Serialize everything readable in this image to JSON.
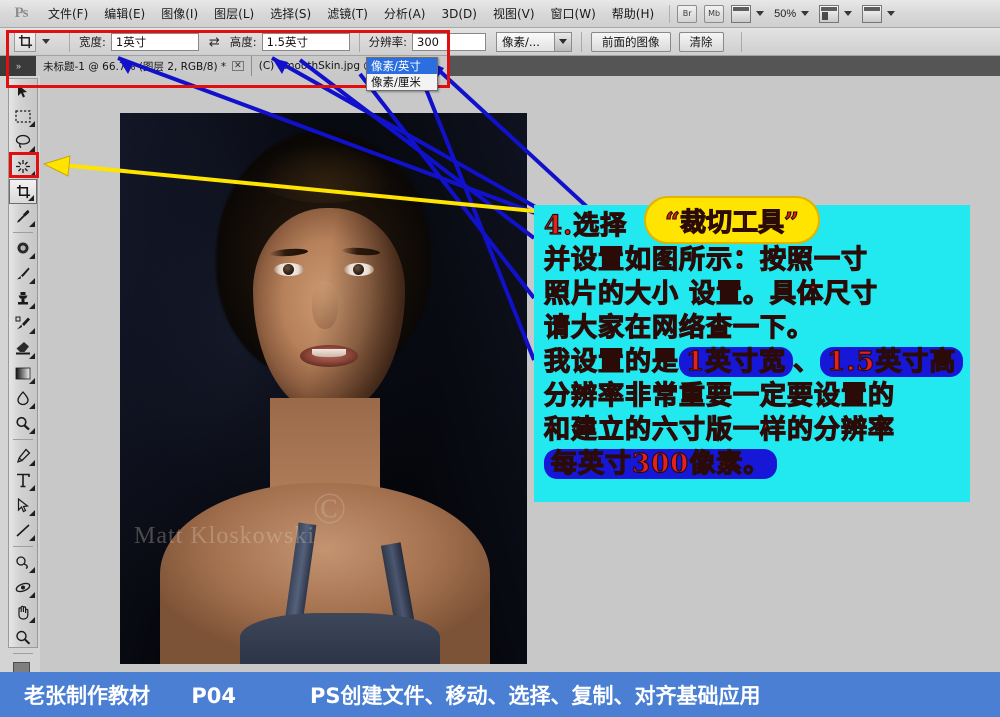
{
  "app": {
    "logo": "Ps",
    "menus": [
      {
        "label": "文件(F)"
      },
      {
        "label": "编辑(E)"
      },
      {
        "label": "图像(I)"
      },
      {
        "label": "图层(L)"
      },
      {
        "label": "选择(S)"
      },
      {
        "label": "滤镜(T)"
      },
      {
        "label": "分析(A)"
      },
      {
        "label": "3D(D)"
      },
      {
        "label": "视图(V)"
      },
      {
        "label": "窗口(W)"
      },
      {
        "label": "帮助(H)"
      }
    ],
    "bridge_button": "Br",
    "minibridge_button": "Mb",
    "zoom_level": "50%"
  },
  "options_bar": {
    "tool_icon": "crop-tool-icon",
    "width_label": "宽度:",
    "width_value": "1英寸",
    "swap_icon": "swap-width-height-icon",
    "height_label": "高度:",
    "height_value": "1.5英寸",
    "resolution_label": "分辨率:",
    "resolution_value": "300",
    "unit_value": "像素/...",
    "front_image_button": "前面的图像",
    "clear_button": "清除"
  },
  "unit_dropdown": {
    "options": [
      {
        "label": "像素/英寸",
        "selected": true
      },
      {
        "label": "像素/厘米",
        "selected": false
      }
    ]
  },
  "tabs": [
    {
      "label": "未标题-1 @ 66.7% (图层 2, RGB/8) *",
      "close": "✕"
    },
    {
      "label": "(C) SmoothSkin.jpg @ 50% (RGB...",
      "close": ""
    }
  ],
  "toolbar": {
    "tools": [
      {
        "name": "move-tool",
        "has_flyout": false
      },
      {
        "name": "rectangular-marquee-tool",
        "has_flyout": true
      },
      {
        "name": "lasso-tool",
        "has_flyout": true
      },
      {
        "name": "magic-wand-tool",
        "has_flyout": true
      },
      {
        "name": "crop-tool",
        "has_flyout": true,
        "active": true
      },
      {
        "name": "eyedropper-tool",
        "has_flyout": true
      },
      {
        "name": "spot-healing-brush-tool",
        "has_flyout": true
      },
      {
        "name": "brush-tool",
        "has_flyout": true
      },
      {
        "name": "clone-stamp-tool",
        "has_flyout": true
      },
      {
        "name": "history-brush-tool",
        "has_flyout": true
      },
      {
        "name": "eraser-tool",
        "has_flyout": true
      },
      {
        "name": "gradient-tool",
        "has_flyout": true
      },
      {
        "name": "blur-tool",
        "has_flyout": true
      },
      {
        "name": "dodge-tool",
        "has_flyout": true
      },
      {
        "name": "pen-tool",
        "has_flyout": true
      },
      {
        "name": "horizontal-type-tool",
        "has_flyout": true
      },
      {
        "name": "path-selection-tool",
        "has_flyout": true
      },
      {
        "name": "line-tool",
        "has_flyout": true
      },
      {
        "name": "3d-rotate-tool",
        "has_flyout": true
      },
      {
        "name": "3d-orbit-tool",
        "has_flyout": true
      },
      {
        "name": "hand-tool",
        "has_flyout": true
      },
      {
        "name": "zoom-tool",
        "has_flyout": false
      }
    ],
    "foreground_color": "#7f7f7f",
    "background_color": "#ffffff",
    "quick_mask": "quick-mask-icon"
  },
  "document": {
    "watermark": "Matt Kloskowski",
    "watermark_mark": "©"
  },
  "annotation": {
    "callout": "“裁切工具”",
    "lines": [
      {
        "segments": [
          {
            "text": "4.选择",
            "style": "plain"
          }
        ]
      },
      {
        "segments": [
          {
            "text": "并设置如图所示：按照一寸",
            "style": "plain"
          }
        ]
      },
      {
        "segments": [
          {
            "text": "照片的大小 设置。具体尺寸",
            "style": "plain"
          }
        ]
      },
      {
        "segments": [
          {
            "text": "请大家在网络查一下。",
            "style": "plain"
          }
        ]
      },
      {
        "segments": [
          {
            "text": "我设置的是",
            "style": "plain"
          },
          {
            "text": "1英寸宽",
            "style": "highlight"
          },
          {
            "text": "、",
            "style": "plain"
          },
          {
            "text": "1.5英寸高",
            "style": "highlight"
          }
        ]
      },
      {
        "segments": [
          {
            "text": "分辨率非常重要一定要设置的",
            "style": "plain"
          }
        ]
      },
      {
        "segments": [
          {
            "text": "和建立的六寸版一样的分辨率",
            "style": "plain"
          }
        ]
      },
      {
        "segments": [
          {
            "text": "每英寸300像素。",
            "style": "highlight"
          }
        ]
      }
    ],
    "panel_color": "#22e9f0",
    "text_color": "#e8201c",
    "highlight_color": "#1717d8",
    "callout_color": "#ffe400",
    "arrow_color_yellow": "#ffe400",
    "arrow_color_blue": "#1111cc",
    "box_color": "#e10f0f"
  },
  "footer": {
    "title": "老张制作教材",
    "page": "P04",
    "subtitle": "PS创建文件、移动、选择、复制、对齐基础应用",
    "background": "#4a7fd4"
  }
}
